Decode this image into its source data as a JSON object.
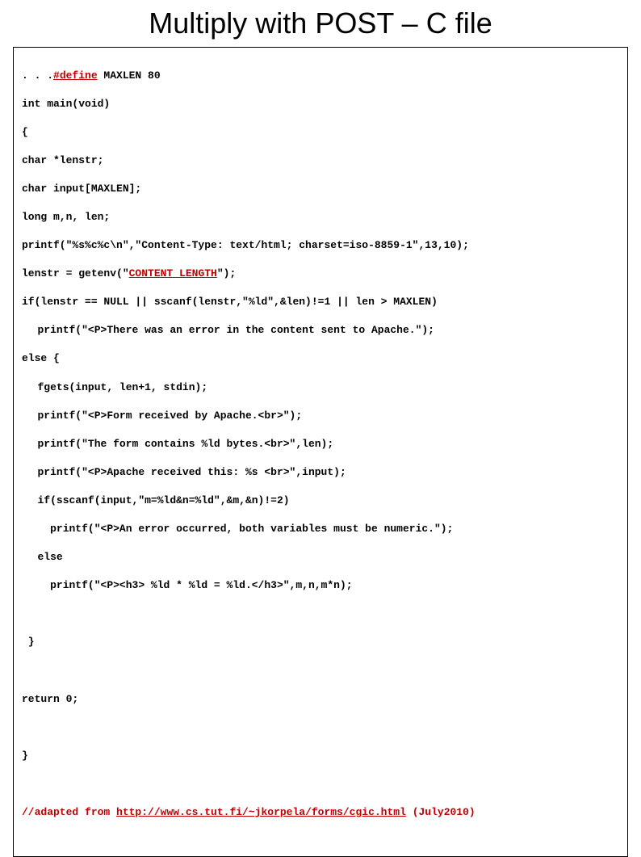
{
  "title": "Multiply with POST – C file",
  "code": {
    "l1a": ". . .",
    "l1b": "#define",
    "l1c": " MAXLEN 80",
    "l2": "int main(void)",
    "l3": "{",
    "l4": "char *lenstr;",
    "l5": "char input[MAXLEN];",
    "l6": "long m,n, len;",
    "l7": "printf(\"%s%c%c\\n\",\"Content-Type: text/html; charset=iso-8859-1\",13,10);",
    "l8a": "lenstr = getenv(\"",
    "l8b": "CONTENT_LENGTH",
    "l8c": "\");",
    "l9": "if(lenstr == NULL || sscanf(lenstr,\"%ld\",&len)!=1 || len > MAXLEN)",
    "l10": "printf(\"<P>There was an error in the content sent to Apache.\");",
    "l11": "else {",
    "l12": "fgets(input, len+1, stdin);",
    "l13": "printf(\"<P>Form received by Apache.<br>\");",
    "l14": "printf(\"The form contains %ld bytes.<br>\",len);",
    "l15": "printf(\"<P>Apache received this: %s <br>\",input);",
    "l16": "if(sscanf(input,\"m=%ld&n=%ld\",&m,&n)!=2)",
    "l17": "  printf(\"<P>An error occurred, both variables must be numeric.\");",
    "l18": "else",
    "l19": "  printf(\"<P><h3> %ld * %ld = %ld.</h3>\",m,n,m*n);",
    "l20": " }",
    "l21": "return 0;",
    "l22": "}",
    "l23a": "//adapted from ",
    "l23b": "http://www.cs.tut.fi/~jkorpela/forms/cgic.html",
    "l23c": " (July2010)"
  }
}
